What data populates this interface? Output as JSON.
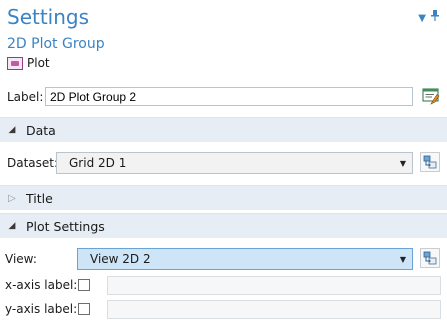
{
  "header": {
    "title": "Settings",
    "subtitle": "2D Plot Group",
    "node_label": "Plot",
    "icons": [
      "dropdown-arrow-icon",
      "pin-icon"
    ]
  },
  "label_field": {
    "label": "Label:",
    "value": "2D Plot Group 2"
  },
  "sections": {
    "data": {
      "name": "Data",
      "expanded": true
    },
    "title": {
      "name": "Title",
      "expanded": false
    },
    "plot_settings": {
      "name": "Plot Settings",
      "expanded": true
    }
  },
  "data_section": {
    "dataset_label": "Dataset:",
    "dataset_value": "Grid 2D 1"
  },
  "plot_settings": {
    "view_label": "View:",
    "view_value": "View 2D 2",
    "xaxis_label": "x-axis label:",
    "xaxis_checked": false,
    "yaxis_label": "y-axis label:",
    "yaxis_checked": false
  },
  "colors": {
    "accent": "#3b83c4",
    "section_bg": "#e6edf5",
    "combo_active": "#cde5f7"
  }
}
